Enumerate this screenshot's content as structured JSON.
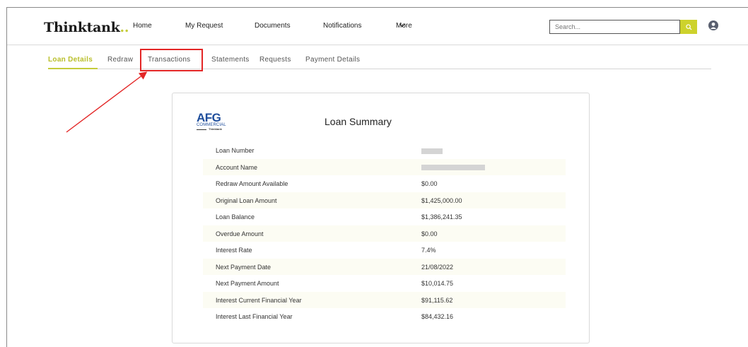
{
  "header": {
    "logo_text": "Thinktank",
    "logo_dots": "..",
    "nav": [
      "Home",
      "My Request",
      "Documents",
      "Notifications",
      "More"
    ],
    "search_placeholder": "Search..."
  },
  "tabs": [
    "Loan Details",
    "Redraw",
    "Transactions",
    "Statements",
    "Requests",
    "Payment Details"
  ],
  "active_tab": "Loan Details",
  "card": {
    "logo": {
      "brand": "AFG",
      "sub": "COMMERCIAL",
      "tagline": "Thinktank"
    },
    "title": "Loan Summary",
    "rows": [
      {
        "label": "Loan Number",
        "value": ""
      },
      {
        "label": "Account Name",
        "value": ""
      },
      {
        "label": "Redraw Amount Available",
        "value": "$0.00"
      },
      {
        "label": "Original Loan Amount",
        "value": "$1,425,000.00"
      },
      {
        "label": "Loan Balance",
        "value": "$1,386,241.35"
      },
      {
        "label": "Overdue Amount",
        "value": "$0.00"
      },
      {
        "label": "Interest Rate",
        "value": "7.4%"
      },
      {
        "label": "Next Payment Date",
        "value": "21/08/2022"
      },
      {
        "label": "Next Payment Amount",
        "value": "$10,014.75"
      },
      {
        "label": "Interest Current Financial Year",
        "value": "$91,115.62"
      },
      {
        "label": "Interest Last Financial Year",
        "value": "$84,432.16"
      }
    ]
  },
  "colors": {
    "accent": "#c5cc3a",
    "annotation": "#e32626",
    "brand_blue": "#1f4e9c"
  },
  "icons": {
    "search": "search-icon",
    "user": "user-avatar-icon",
    "more": "chevron-down-icon"
  }
}
